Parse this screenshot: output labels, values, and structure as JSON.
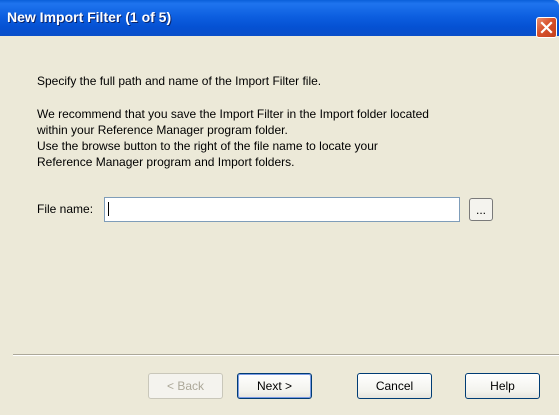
{
  "window": {
    "title": "New Import Filter (1 of 5)"
  },
  "instructions": {
    "line1": "Specify the full path and name of the Import Filter file.",
    "para2": [
      "We recommend that you save the Import Filter in the Import folder located",
      "within your Reference Manager program folder.",
      "Use the browse button to the right of the file name to locate your",
      "Reference Manager program and Import folders."
    ]
  },
  "file_name": {
    "label": "File name:",
    "value": "",
    "browse_label": "..."
  },
  "buttons": {
    "back": "< Back",
    "next": "Next >",
    "cancel": "Cancel",
    "help": "Help"
  },
  "colors": {
    "titlebar": "#0551d3",
    "dialog_bg": "#ECE9D8",
    "close_button": "#d8512c"
  },
  "icons": {
    "close": "close-icon"
  }
}
